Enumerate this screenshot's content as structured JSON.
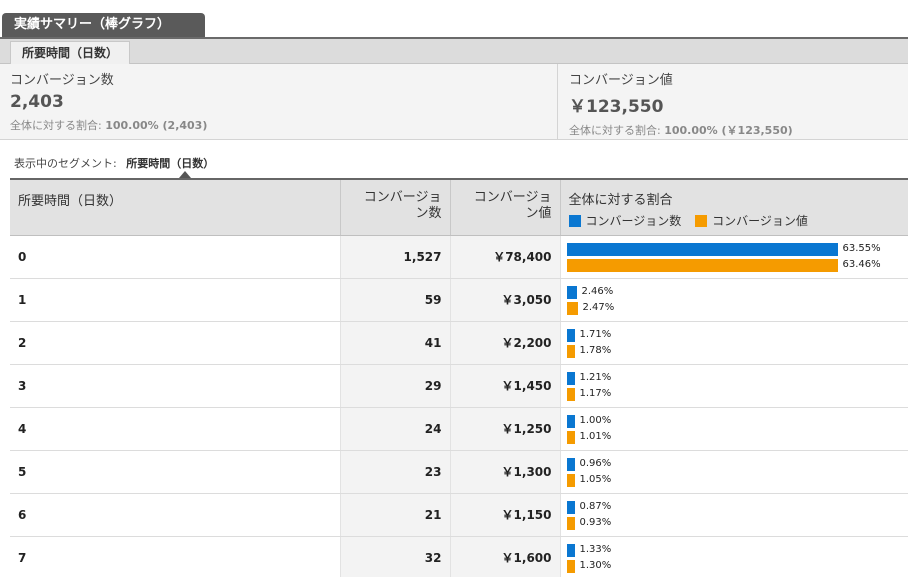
{
  "title_tab": "実績サマリー（棒グラフ）",
  "subtab": "所要時間（日数）",
  "colors": {
    "conv_count": "#0a77d1",
    "conv_value": "#f59b00"
  },
  "summary": {
    "count": {
      "label": "コンバージョン数",
      "value": "2,403",
      "pct_prefix": "全体に対する割合:",
      "pct_value": "100.00% (2,403)"
    },
    "value": {
      "label": "コンバージョン値",
      "value": "￥123,550",
      "pct_prefix": "全体に対する割合:",
      "pct_value": "100.00% (￥123,550)"
    }
  },
  "segment": {
    "label": "表示中のセグメント:",
    "value": "所要時間（日数）"
  },
  "table": {
    "headers": {
      "dim": "所要時間（日数）",
      "count_line1": "コンバージョ",
      "count_line2": "ン数",
      "value_line1": "コンバージョ",
      "value_line2": "ン値",
      "share": "全体に対する割合",
      "legend_count": "コンバージョン数",
      "legend_value": "コンバージョン値"
    },
    "rows": [
      {
        "dim": "0",
        "count": "1,527",
        "value": "￥78,400",
        "count_pct": "63.55%",
        "value_pct": "63.46%",
        "count_share": 0.6355,
        "value_share": 0.6346
      },
      {
        "dim": "1",
        "count": "59",
        "value": "￥3,050",
        "count_pct": "2.46%",
        "value_pct": "2.47%",
        "count_share": 0.0246,
        "value_share": 0.0247
      },
      {
        "dim": "2",
        "count": "41",
        "value": "￥2,200",
        "count_pct": "1.71%",
        "value_pct": "1.78%",
        "count_share": 0.0171,
        "value_share": 0.0178
      },
      {
        "dim": "3",
        "count": "29",
        "value": "￥1,450",
        "count_pct": "1.21%",
        "value_pct": "1.17%",
        "count_share": 0.0121,
        "value_share": 0.0117
      },
      {
        "dim": "4",
        "count": "24",
        "value": "￥1,250",
        "count_pct": "1.00%",
        "value_pct": "1.01%",
        "count_share": 0.01,
        "value_share": 0.0101
      },
      {
        "dim": "5",
        "count": "23",
        "value": "￥1,300",
        "count_pct": "0.96%",
        "value_pct": "1.05%",
        "count_share": 0.0096,
        "value_share": 0.0105
      },
      {
        "dim": "6",
        "count": "21",
        "value": "￥1,150",
        "count_pct": "0.87%",
        "value_pct": "0.93%",
        "count_share": 0.0087,
        "value_share": 0.0093
      },
      {
        "dim": "7",
        "count": "32",
        "value": "￥1,600",
        "count_pct": "1.33%",
        "value_pct": "1.30%",
        "count_share": 0.0133,
        "value_share": 0.013
      }
    ]
  }
}
